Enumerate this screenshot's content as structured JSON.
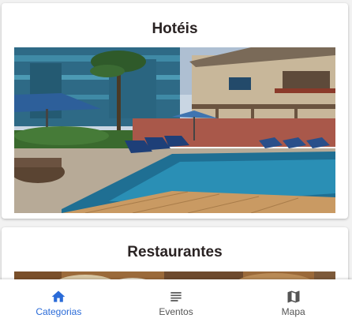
{
  "categories": [
    {
      "title": "Hotéis",
      "image": "hotel-pool-photo"
    },
    {
      "title": "Restaurantes",
      "image": "restaurant-food-photo"
    }
  ],
  "bottom_nav": {
    "active_color": "#2a6bd8",
    "items": [
      {
        "label": "Categorias",
        "icon": "home-icon",
        "active": true
      },
      {
        "label": "Eventos",
        "icon": "list-icon",
        "active": false
      },
      {
        "label": "Mapa",
        "icon": "map-icon",
        "active": false
      }
    ]
  }
}
